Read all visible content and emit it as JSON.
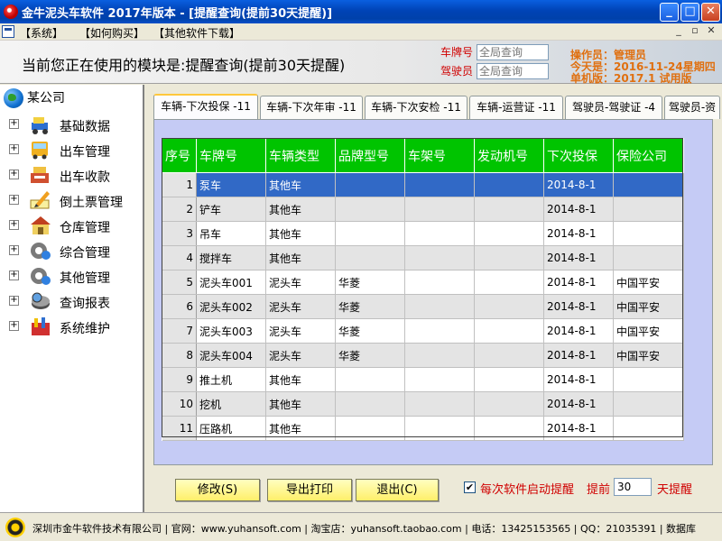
{
  "window": {
    "title": "金牛泥头车软件 2017年版本 - [提醒查询(提前30天提醒)]",
    "minimize": "_",
    "maximize": "□",
    "close": "✕"
  },
  "menu": {
    "items": [
      "【系统】",
      "【如何购买】",
      "【其他软件下载】"
    ],
    "mdi_min": "_",
    "mdi_restore": "▫",
    "mdi_close": "✕"
  },
  "header": {
    "module_text": "当前您正在使用的模块是:提醒查询(提前30天提醒)",
    "plate_label": "车牌号",
    "plate_placeholder": "全局查询",
    "driver_label": "驾驶员",
    "driver_placeholder": "全局查询",
    "operator": "操作员：管理员",
    "today": "今天是：2016-11-24星期四",
    "version": "单机版：2017.1 试用版"
  },
  "tree": {
    "root": "某公司",
    "nodes": [
      {
        "label": "基础数据",
        "icon": "truck-data-icon"
      },
      {
        "label": "出车管理",
        "icon": "bus-icon"
      },
      {
        "label": "出车收款",
        "icon": "cash-register-icon"
      },
      {
        "label": "倒土票管理",
        "icon": "pencil-note-icon"
      },
      {
        "label": "仓库管理",
        "icon": "warehouse-icon"
      },
      {
        "label": "综合管理",
        "icon": "gear-globe-icon"
      },
      {
        "label": "其他管理",
        "icon": "gear-globe-icon"
      },
      {
        "label": "查询报表",
        "icon": "database-icon"
      },
      {
        "label": "系统维护",
        "icon": "tools-icon"
      }
    ]
  },
  "tabs": [
    "车辆-下次投保 -11",
    "车辆-下次年审 -11",
    "车辆-下次安检 -11",
    "车辆-运营证 -11",
    "驾驶员-驾驶证 -4",
    "驾驶员-资"
  ],
  "table": {
    "headers": [
      "序号",
      "车牌号",
      "车辆类型",
      "品牌型号",
      "车架号",
      "发动机号",
      "下次投保",
      "保险公司"
    ],
    "rows": [
      [
        "1",
        "泵车",
        "其他车",
        "",
        "",
        "",
        "2014-8-1",
        ""
      ],
      [
        "2",
        "铲车",
        "其他车",
        "",
        "",
        "",
        "2014-8-1",
        ""
      ],
      [
        "3",
        "吊车",
        "其他车",
        "",
        "",
        "",
        "2014-8-1",
        ""
      ],
      [
        "4",
        "搅拌车",
        "其他车",
        "",
        "",
        "",
        "2014-8-1",
        ""
      ],
      [
        "5",
        "泥头车001",
        "泥头车",
        "华菱",
        "",
        "",
        "2014-8-1",
        "中国平安"
      ],
      [
        "6",
        "泥头车002",
        "泥头车",
        "华菱",
        "",
        "",
        "2014-8-1",
        "中国平安"
      ],
      [
        "7",
        "泥头车003",
        "泥头车",
        "华菱",
        "",
        "",
        "2014-8-1",
        "中国平安"
      ],
      [
        "8",
        "泥头车004",
        "泥头车",
        "华菱",
        "",
        "",
        "2014-8-1",
        "中国平安"
      ],
      [
        "9",
        "推土机",
        "其他车",
        "",
        "",
        "",
        "2014-8-1",
        ""
      ],
      [
        "10",
        "挖机",
        "其他车",
        "",
        "",
        "",
        "2014-8-1",
        ""
      ],
      [
        "11",
        "压路机",
        "其他车",
        "",
        "",
        "",
        "2014-8-1",
        ""
      ]
    ]
  },
  "buttons": {
    "edit": "修改(S)",
    "export": "导出打印",
    "exit": "退出(C)"
  },
  "reminder": {
    "checkbox_checked": "✔",
    "checkbox_label": "每次软件启动提醒",
    "advance_label": "提前",
    "days_value": "30",
    "days_unit": "天提醒"
  },
  "status": {
    "text": "深圳市金牛软件技术有限公司 | 官网：www.yuhansoft.com | 淘宝店：yuhansoft.taobao.com | 电话：13425153565 | QQ：21035391 | 数据库"
  },
  "colors": {
    "header_green": "#00C400",
    "selection_blue": "#3169C6",
    "panel_lavender": "#C5CBF5",
    "button_yellow": "#FFEF6A",
    "alert_red": "#D00000",
    "info_orange": "#E07010"
  }
}
